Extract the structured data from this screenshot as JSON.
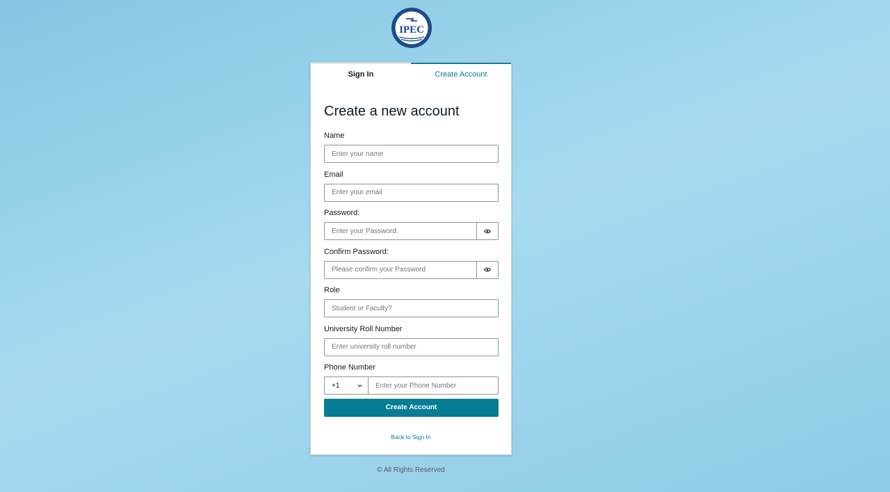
{
  "logo": {
    "text": "IPEC",
    "primary_color": "#1d4c8c"
  },
  "tabs": [
    {
      "label": "Sign In",
      "active": false
    },
    {
      "label": "Create Account",
      "active": true
    }
  ],
  "form": {
    "title": "Create a new account",
    "name": {
      "label": "Name",
      "placeholder": "Enter your name"
    },
    "email": {
      "label": "Email",
      "placeholder": "Enter your email"
    },
    "password": {
      "label": "Password:",
      "placeholder": "Enter your Password:",
      "icon": "eye-icon"
    },
    "confirm_password": {
      "label": "Confirm Password:",
      "placeholder": "Please confirm your Password",
      "icon": "eye-icon"
    },
    "role": {
      "label": "Role",
      "placeholder": "Student or Faculty?"
    },
    "roll_number": {
      "label": "University Roll Number",
      "placeholder": "Enter university roll number"
    },
    "phone": {
      "label": "Phone Number",
      "country_code": "+1",
      "placeholder": "Enter your Phone Number",
      "icon": "chevron-down-icon"
    },
    "submit_label": "Create Account",
    "back_link": "Back to Sign In"
  },
  "footer": {
    "text": "© All Rights Reserved"
  },
  "colors": {
    "accent": "#047d95",
    "background": "#9fd6ec",
    "card": "#ffffff"
  }
}
